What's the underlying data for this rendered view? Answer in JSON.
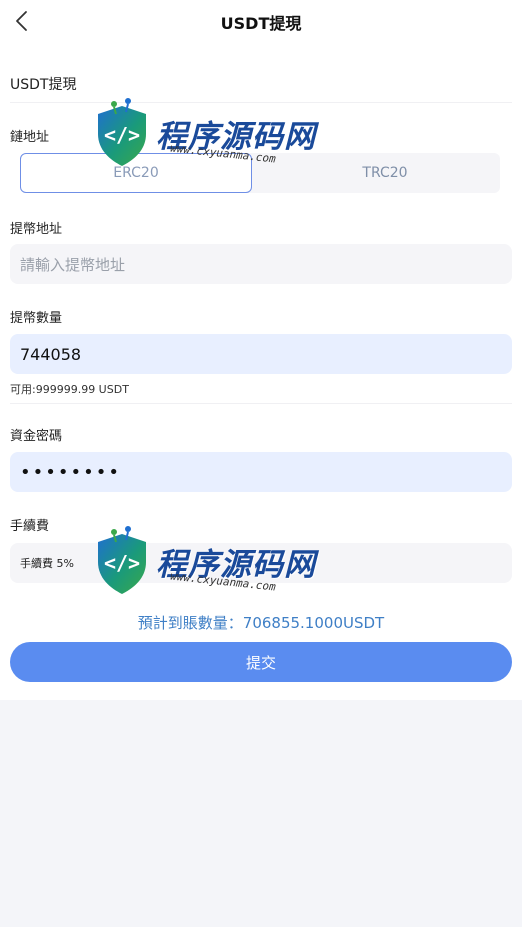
{
  "header": {
    "title": "USDT提現"
  },
  "section": {
    "title": "USDT提現"
  },
  "chain": {
    "label": "鏈地址",
    "options": [
      "ERC20",
      "TRC20"
    ],
    "selected": "ERC20"
  },
  "address": {
    "label": "提幣地址",
    "placeholder": "請輸入提幣地址",
    "value": ""
  },
  "amount": {
    "label": "提幣數量",
    "value": "744058",
    "available": "可用:999999.99 USDT"
  },
  "password": {
    "label": "資金密碼",
    "value": "••••••••"
  },
  "fee": {
    "label": "手續費",
    "value": "手續費 5%"
  },
  "estimate": {
    "text": "預計到賬數量：706855.1000USDT"
  },
  "submit": {
    "label": "提交"
  },
  "watermark": {
    "cn": "程序源码网",
    "url": "www.cxyuanma.com"
  },
  "colors": {
    "primary": "#5a8cf0",
    "estimate": "#3f7fc6",
    "input_active": "#e8efff"
  }
}
